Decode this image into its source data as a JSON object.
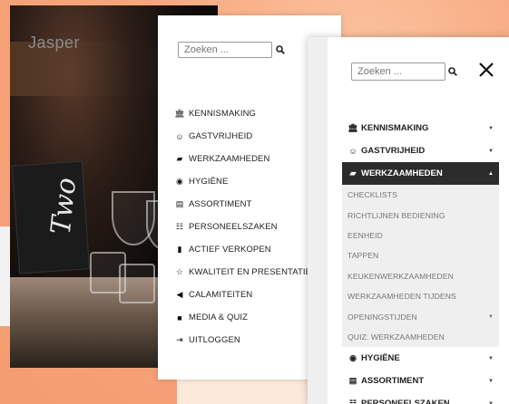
{
  "photo_screen": {
    "title": "Jasper",
    "card_logo": "Two"
  },
  "menu_screen_1": {
    "search": {
      "placeholder": "Zoeken ...",
      "icon": "search-icon"
    },
    "items": [
      {
        "label": "KENNISMAKING",
        "icon": "building-icon",
        "glyph": "🏛"
      },
      {
        "label": "GASTVRIJHEID",
        "icon": "smile-icon",
        "glyph": "☺"
      },
      {
        "label": "WERKZAAMHEDEN",
        "icon": "document-icon",
        "glyph": "▰"
      },
      {
        "label": "HYGIËNE",
        "icon": "eye-icon",
        "glyph": "◉"
      },
      {
        "label": "ASSORTIMENT",
        "icon": "list-icon",
        "glyph": "▤"
      },
      {
        "label": "PERSONEELSZAKEN",
        "icon": "people-icon",
        "glyph": "☷"
      },
      {
        "label": "ACTIEF VERKOPEN",
        "icon": "bar-chart-icon",
        "glyph": "▮"
      },
      {
        "label": "KWALITEIT EN PRESENTATIE",
        "icon": "star-icon",
        "glyph": "☆"
      },
      {
        "label": "CALAMITEITEN",
        "icon": "megaphone-icon",
        "glyph": "◀"
      },
      {
        "label": "MEDIA & QUIZ",
        "icon": "video-icon",
        "glyph": "■"
      },
      {
        "label": "UITLOGGEN",
        "icon": "logout-icon",
        "glyph": "⇥"
      }
    ]
  },
  "menu_screen_2": {
    "search": {
      "placeholder": "Zoeken ...",
      "icon": "search-icon"
    },
    "close_icon": "close-icon",
    "items_top": [
      {
        "label": "KENNISMAKING",
        "icon": "building-icon",
        "glyph": "🏛"
      },
      {
        "label": "GASTVRIJHEID",
        "icon": "smile-icon",
        "glyph": "☺"
      }
    ],
    "active": {
      "label": "WERKZAAMHEDEN",
      "icon": "document-icon",
      "glyph": "▰"
    },
    "submenu": [
      {
        "label": "CHECKLISTS",
        "has_children": false
      },
      {
        "label": "RICHTLIJNEN BEDIENING",
        "has_children": false
      },
      {
        "label": "EENHEID",
        "has_children": false
      },
      {
        "label": "TAPPEN",
        "has_children": false
      },
      {
        "label": "KEUKENWERKZAAMHEDEN",
        "has_children": false
      },
      {
        "label": "WERKZAAMHEDEN TIJDENS",
        "has_children": false
      },
      {
        "label": "OPENINGSTIJDEN",
        "has_children": true
      },
      {
        "label": "QUIZ: WERKZAAMHEDEN",
        "has_children": false
      }
    ],
    "items_bottom": [
      {
        "label": "HYGIËNE",
        "icon": "eye-icon",
        "glyph": "◉"
      },
      {
        "label": "ASSORTIMENT",
        "icon": "list-icon",
        "glyph": "▤"
      },
      {
        "label": "PERSONEELSZAKEN",
        "icon": "people-icon",
        "glyph": "☷"
      }
    ]
  },
  "colors": {
    "background": "#f7a87f",
    "active_item_bg": "#2c2c2c",
    "submenu_bg": "#efefef",
    "submenu_text": "#777777"
  }
}
